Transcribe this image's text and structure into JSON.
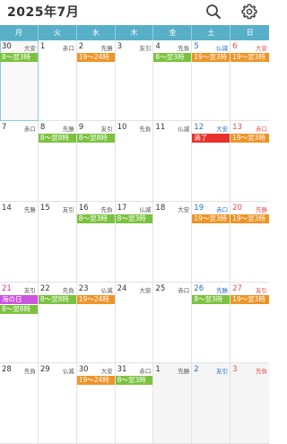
{
  "header": {
    "title": "2025年7月",
    "search_icon": "search-icon",
    "settings_icon": "gear-icon"
  },
  "weekdays": [
    "月",
    "火",
    "水",
    "木",
    "金",
    "土",
    "日"
  ],
  "colors": {
    "weekbar": "#58b0c8",
    "event_green": "#7bc23f",
    "event_orange": "#ee9427",
    "event_red": "#e8312b",
    "event_violet": "#cc55e0",
    "saturday": "#2a6fc9",
    "sunday": "#e05050"
  },
  "cells": [
    {
      "day": "30",
      "rokuyo": "大安",
      "events": [
        {
          "text": "8〜翌3時",
          "color": "green"
        }
      ]
    },
    {
      "day": "1",
      "rokuyo": "赤口",
      "events": []
    },
    {
      "day": "2",
      "rokuyo": "先勝",
      "events": [
        {
          "text": "19〜24時",
          "color": "orange"
        }
      ]
    },
    {
      "day": "3",
      "rokuyo": "友引",
      "events": []
    },
    {
      "day": "4",
      "rokuyo": "先負",
      "events": [
        {
          "text": "8〜翌3時",
          "color": "green"
        }
      ]
    },
    {
      "day": "5",
      "rokuyo": "仏滅",
      "events": [
        {
          "text": "19〜翌3時",
          "color": "orange"
        }
      ]
    },
    {
      "day": "6",
      "rokuyo": "大安",
      "events": [
        {
          "text": "19〜翌3時",
          "color": "orange"
        }
      ]
    },
    {
      "day": "7",
      "rokuyo": "赤口",
      "events": []
    },
    {
      "day": "8",
      "rokuyo": "先勝",
      "events": [
        {
          "text": "8〜翌8時",
          "color": "green"
        }
      ]
    },
    {
      "day": "9",
      "rokuyo": "友引",
      "events": [
        {
          "text": "8〜翌8時",
          "color": "green"
        }
      ]
    },
    {
      "day": "10",
      "rokuyo": "先負",
      "events": []
    },
    {
      "day": "11",
      "rokuyo": "仏滅",
      "events": []
    },
    {
      "day": "12",
      "rokuyo": "大安",
      "events": [
        {
          "text": "満了",
          "color": "red"
        }
      ]
    },
    {
      "day": "13",
      "rokuyo": "赤口",
      "events": [
        {
          "text": "19〜翌3時",
          "color": "orange"
        }
      ]
    },
    {
      "day": "14",
      "rokuyo": "先勝",
      "events": []
    },
    {
      "day": "15",
      "rokuyo": "友引",
      "events": []
    },
    {
      "day": "16",
      "rokuyo": "先負",
      "events": [
        {
          "text": "8〜翌3時",
          "color": "green"
        }
      ]
    },
    {
      "day": "17",
      "rokuyo": "仏滅",
      "events": [
        {
          "text": "8〜翌3時",
          "color": "green"
        }
      ]
    },
    {
      "day": "18",
      "rokuyo": "大安",
      "events": []
    },
    {
      "day": "19",
      "rokuyo": "赤口",
      "events": [
        {
          "text": "19〜翌3時",
          "color": "orange"
        }
      ]
    },
    {
      "day": "20",
      "rokuyo": "先勝",
      "events": [
        {
          "text": "19〜翌3時",
          "color": "orange"
        }
      ]
    },
    {
      "day": "21",
      "rokuyo": "友引",
      "holiday": "海の日",
      "events": [
        {
          "text": "海の日",
          "color": "violet"
        },
        {
          "text": "8〜翌8時",
          "color": "green"
        }
      ]
    },
    {
      "day": "22",
      "rokuyo": "先負",
      "events": [
        {
          "text": "8〜翌8時",
          "color": "green"
        }
      ]
    },
    {
      "day": "23",
      "rokuyo": "仏滅",
      "events": [
        {
          "text": "19〜24時",
          "color": "orange"
        }
      ]
    },
    {
      "day": "24",
      "rokuyo": "大安",
      "events": []
    },
    {
      "day": "25",
      "rokuyo": "赤口",
      "events": []
    },
    {
      "day": "26",
      "rokuyo": "先勝",
      "events": [
        {
          "text": "8〜翌3時",
          "color": "green"
        }
      ]
    },
    {
      "day": "27",
      "rokuyo": "友引",
      "events": [
        {
          "text": "19〜翌3時",
          "color": "orange"
        }
      ]
    },
    {
      "day": "28",
      "rokuyo": "先負",
      "events": []
    },
    {
      "day": "29",
      "rokuyo": "仏滅",
      "events": []
    },
    {
      "day": "30",
      "rokuyo": "大安",
      "events": [
        {
          "text": "19〜24時",
          "color": "orange"
        }
      ]
    },
    {
      "day": "31",
      "rokuyo": "赤口",
      "events": [
        {
          "text": "8〜翌3時",
          "color": "green"
        }
      ]
    },
    {
      "day": "1",
      "rokuyo": "先勝",
      "events": []
    },
    {
      "day": "2",
      "rokuyo": "友引",
      "events": []
    },
    {
      "day": "3",
      "rokuyo": "先負",
      "events": []
    }
  ]
}
